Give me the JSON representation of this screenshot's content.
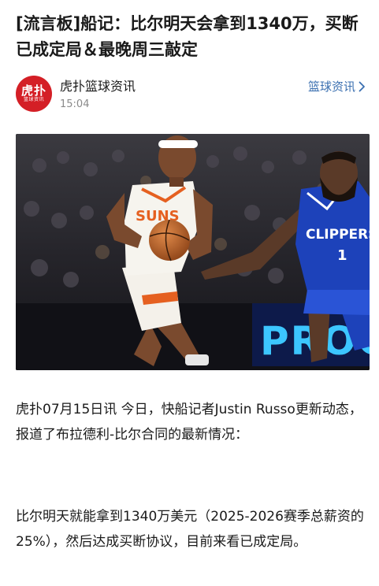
{
  "article": {
    "title": "[流言板]船记：比尔明天会拿到1340万，买断已成定局＆最晚周三敲定",
    "author": {
      "name": "虎扑篮球资讯",
      "time": "15:04",
      "avatar_text_main": "虎扑",
      "avatar_text_sub": "篮球资讯"
    },
    "channel_link": {
      "label": "篮球资讯",
      "icon": "chevron-right-icon"
    },
    "photo": {
      "jersey_left": "SUNS",
      "jersey_right": "CLIPPERS",
      "jersey_right_number": "1",
      "board_text": "PROG"
    },
    "paragraphs": [
      "虎扑07月15日讯 今日，快船记者Justin Russo更新动态，报道了布拉德利-比尔合同的最新情况：",
      "比尔明天就能拿到1340万美元（2025-2026赛季总薪资的25%），然后达成买断协议，目前来看已成定局。"
    ]
  },
  "colors": {
    "accent_link": "#3a6fb0",
    "avatar_bg": "#d41f26",
    "suns_orange": "#e56020",
    "clippers_blue": "#1d42ba"
  }
}
